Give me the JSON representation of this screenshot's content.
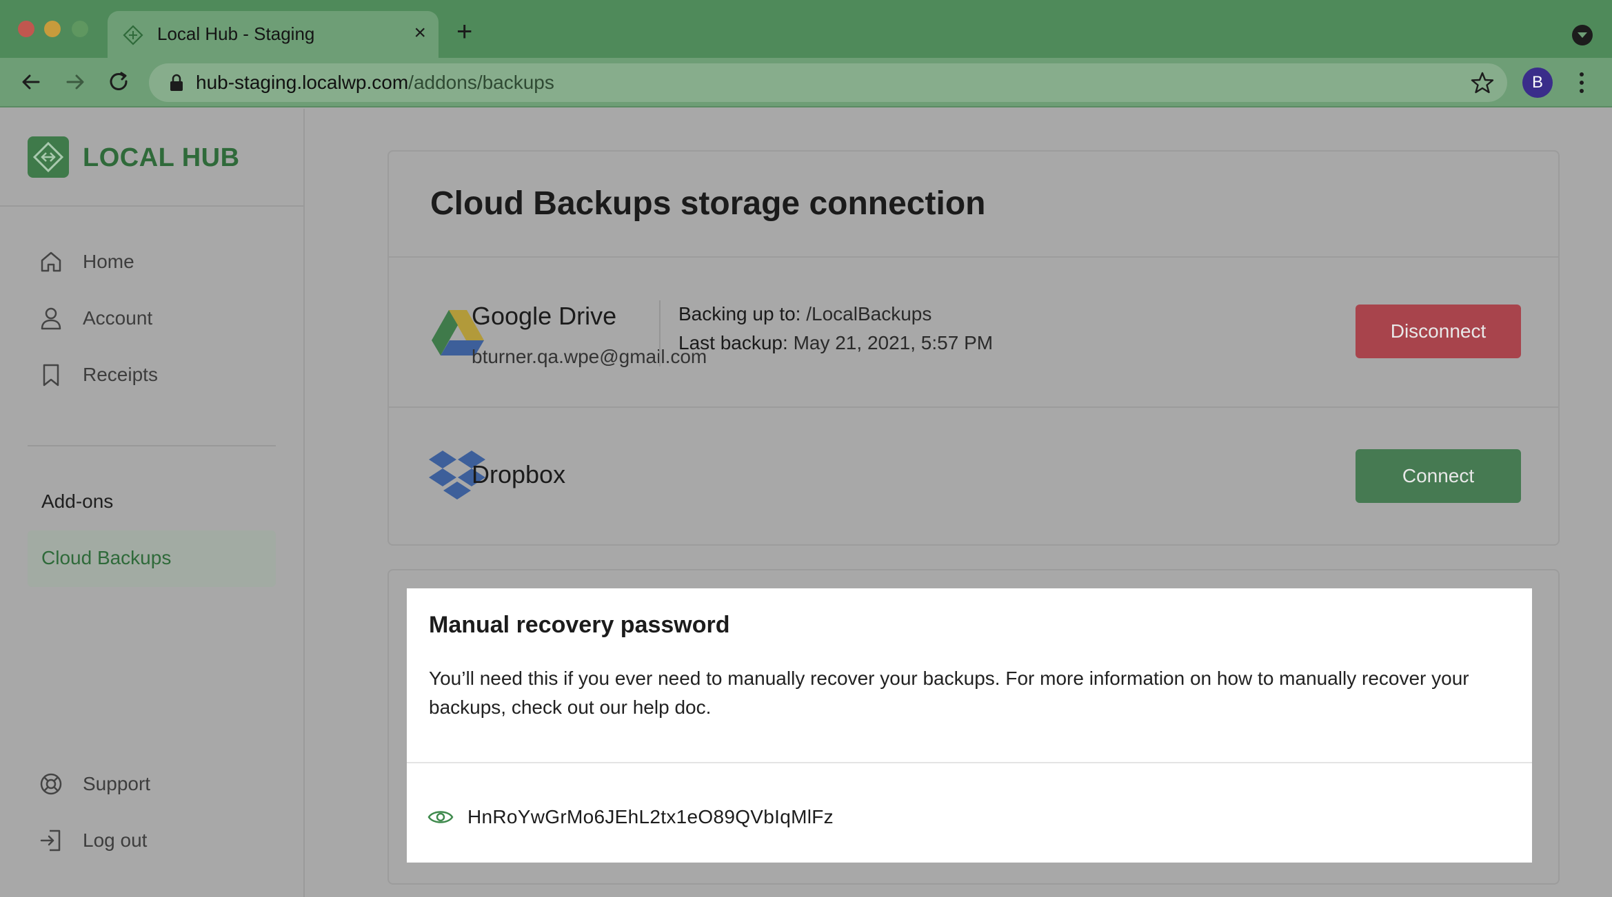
{
  "browser": {
    "tab_title": "Local Hub - Staging",
    "tab_close": "×",
    "new_tab": "+",
    "url_domain": "hub-staging.localwp.com",
    "url_path": "/addons/backups",
    "profile_initial": "B"
  },
  "sidebar": {
    "brand": "LOCAL HUB",
    "nav": [
      {
        "label": "Home",
        "icon": "home-icon"
      },
      {
        "label": "Account",
        "icon": "user-icon"
      },
      {
        "label": "Receipts",
        "icon": "bookmark-icon"
      }
    ],
    "section_label": "Add-ons",
    "active_item": "Cloud Backups",
    "footer": [
      {
        "label": "Support",
        "icon": "lifebuoy-icon"
      },
      {
        "label": "Log out",
        "icon": "logout-icon"
      }
    ]
  },
  "main": {
    "title": "Cloud Backups storage connection",
    "google_drive": {
      "name": "Google Drive",
      "email": "bturner.qa.wpe@gmail.com",
      "backing_up_label": "Backing up to:",
      "backing_up_value": "/LocalBackups",
      "last_backup_label": "Last backup:",
      "last_backup_value": "May 21, 2021, 5:57 PM",
      "button": "Disconnect"
    },
    "dropbox": {
      "name": "Dropbox",
      "button": "Connect"
    },
    "recovery": {
      "title": "Manual recovery password",
      "description": "You’ll need this if you ever need to manually recover your backups. For more information on how to manually recover your backups, check out our help doc.",
      "password": "HnRoYwGrMo6JEhL2tx1eO89QVbIqMlFz"
    }
  },
  "colors": {
    "brand_green": "#2f6a3a",
    "chrome_green": "#4f8a5a",
    "disconnect_red": "#a8444c",
    "connect_green": "#467a52"
  }
}
